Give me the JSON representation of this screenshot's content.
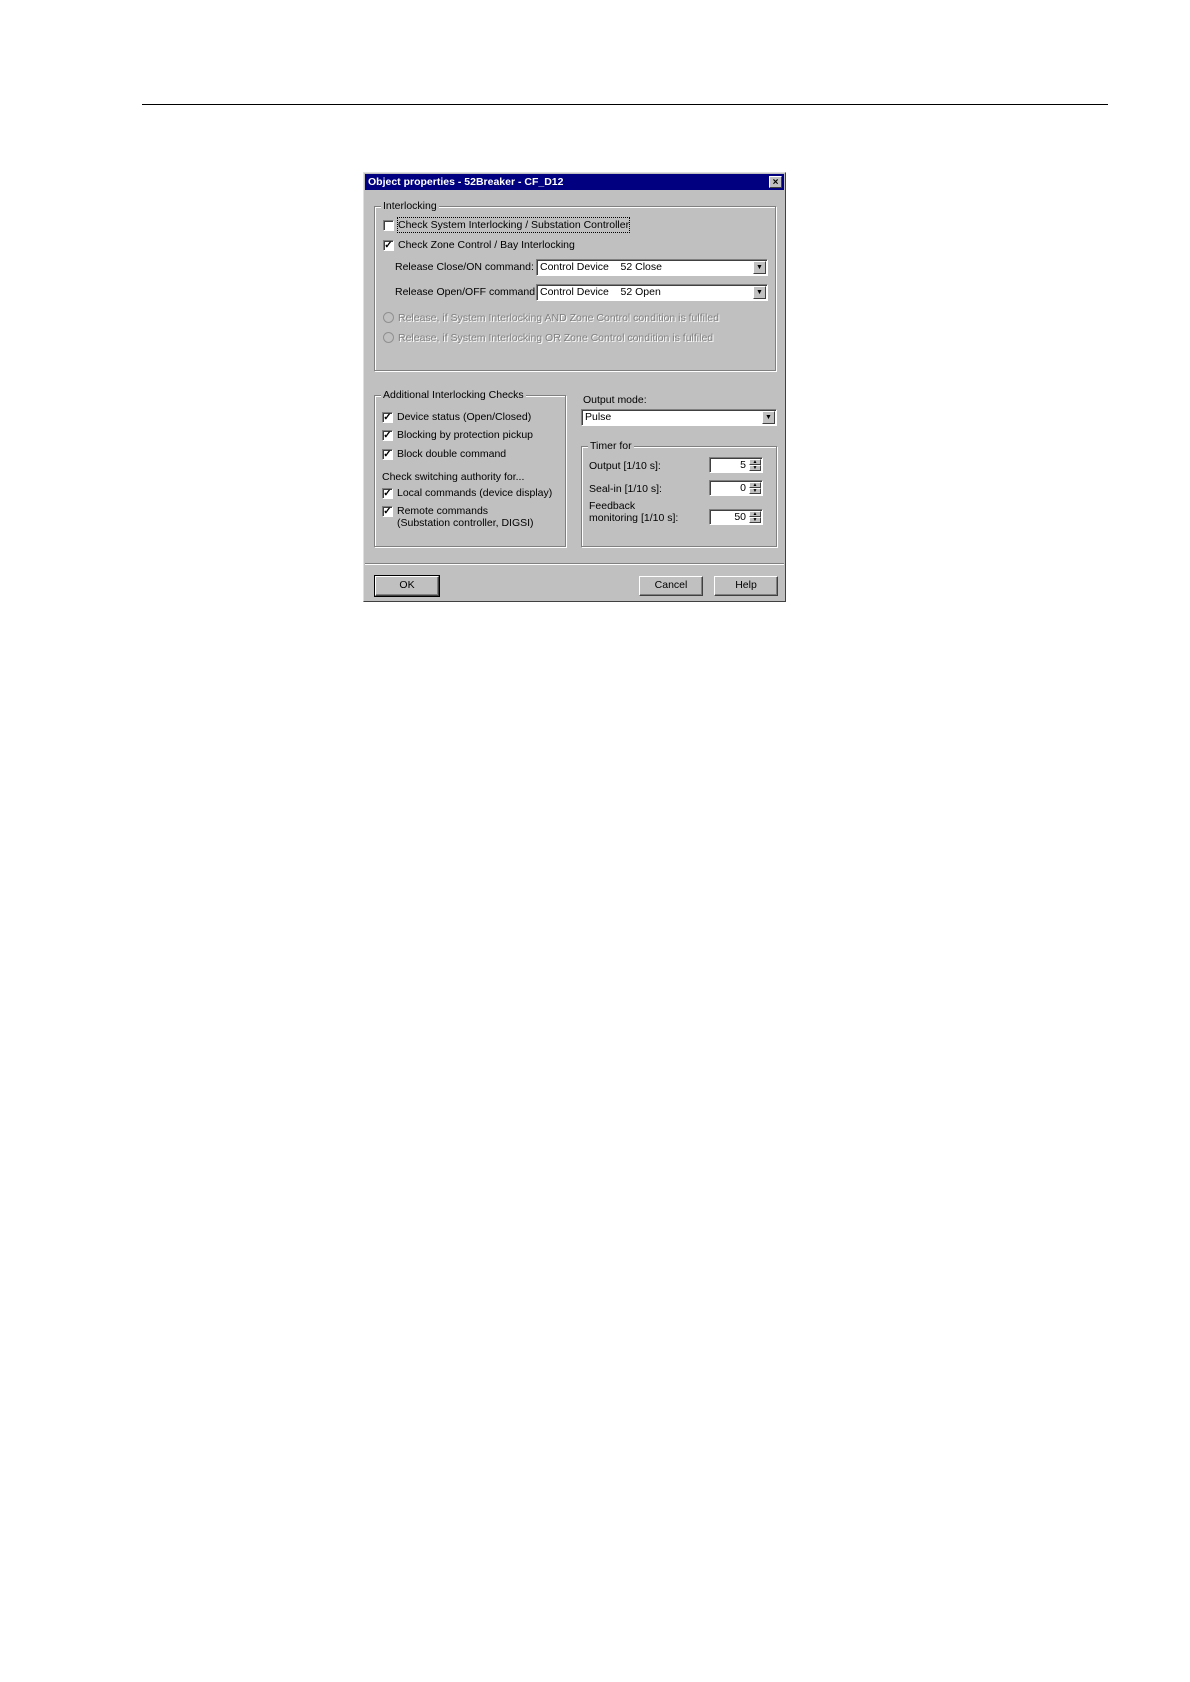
{
  "dialog": {
    "title": "Object properties - 52Breaker - CF_D12",
    "close_label": "×"
  },
  "interlocking": {
    "group_label": "Interlocking",
    "check_system": {
      "label": "Check System Interlocking / Substation Controller",
      "checked": false
    },
    "check_zone": {
      "label": "Check Zone Control / Bay Interlocking",
      "checked": true
    },
    "release_close": {
      "label": "Release Close/ON command:",
      "value": "Control Device    52 Close"
    },
    "release_open": {
      "label": "Release Open/OFF command:",
      "value": "Control Device    52 Open"
    },
    "radio_and": {
      "label": "Release, if System Interlocking AND Zone Control condition is fulfiled"
    },
    "radio_or": {
      "label": "Release, if System Interlocking OR Zone Control condition is fulfiled"
    }
  },
  "additional": {
    "group_label": "Additional Interlocking Checks",
    "device_status": {
      "label": "Device status (Open/Closed)",
      "checked": true
    },
    "blocking_pickup": {
      "label": "Blocking by protection pickup",
      "checked": true
    },
    "block_double": {
      "label": "Block double command",
      "checked": true
    },
    "authority_label": "Check switching authority for...",
    "local_commands": {
      "label": "Local commands (device display)",
      "checked": true
    },
    "remote_commands": {
      "label": "Remote commands",
      "sublabel": "(Substation controller, DIGSI)",
      "checked": true
    }
  },
  "output": {
    "mode_label": "Output mode:",
    "mode_value": "Pulse"
  },
  "timer": {
    "group_label": "Timer for",
    "output_label": "Output [1/10 s]:",
    "output_value": "5",
    "sealin_label": "Seal-in [1/10 s]:",
    "sealin_value": "0",
    "feedback_label1": "Feedback",
    "feedback_label2": "monitoring [1/10 s]:",
    "feedback_value": "50"
  },
  "buttons": {
    "ok": "OK",
    "cancel": "Cancel",
    "help": "Help"
  },
  "glyphs": {
    "check": "✓",
    "arrow_down": "▼",
    "arrow_up": "▲"
  }
}
